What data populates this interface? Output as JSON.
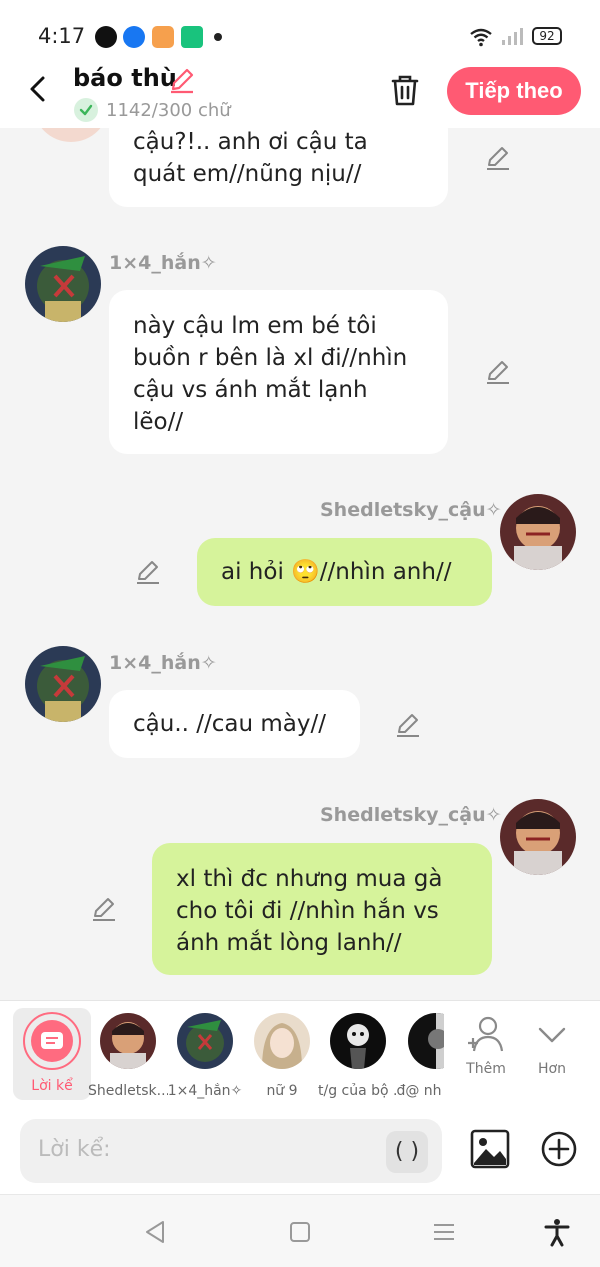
{
  "status": {
    "time": "4:17",
    "battery": "92",
    "app_icons": [
      "messenger-icon",
      "facebook-icon",
      "game-icon",
      "spreadsheet-icon"
    ]
  },
  "header": {
    "title": "báo thù",
    "count": "1142/300 chữ",
    "next_label": "Tiếp theo"
  },
  "messages": [
    {
      "side": "left",
      "sender": "",
      "lines": [
        "cậu?!.. anh ơi cậu ta",
        "quát em//nũng nịu//"
      ]
    },
    {
      "side": "left",
      "sender": "1×4_hắn✧",
      "lines": [
        "này cậu lm em bé tôi",
        "buồn r bên là xl đi//nhìn",
        "cậu vs ánh mắt lạnh",
        "lẽo//"
      ]
    },
    {
      "side": "right",
      "sender": "Shedletsky_cậu✧",
      "lines": [
        "ai hỏi 🙄//nhìn anh//"
      ]
    },
    {
      "side": "left",
      "sender": "1×4_hắn✧",
      "lines": [
        "cậu.. //cau mày//"
      ]
    },
    {
      "side": "right",
      "sender": "Shedletsky_cậu✧",
      "lines": [
        "xl thì đc nhưng mua gà",
        "cho tôi đi //nhìn hắn vs",
        "ánh mắt lòng lanh//"
      ]
    }
  ],
  "characters": [
    {
      "name": "Lời kể"
    },
    {
      "name": "Shedletsk..."
    },
    {
      "name": "1×4_hắn✧"
    },
    {
      "name": "nữ 9"
    },
    {
      "name": "t/g của bộ ..."
    },
    {
      "name": "đ@ nh"
    }
  ],
  "controls": {
    "add_label": "Thêm",
    "more_label": "Hơn"
  },
  "input": {
    "placeholder": "Lời kể:",
    "paren": "( )"
  },
  "colors": {
    "accent": "#ff5a73",
    "right_bubble": "#d6f39b",
    "left_bubble": "#ffffff"
  }
}
